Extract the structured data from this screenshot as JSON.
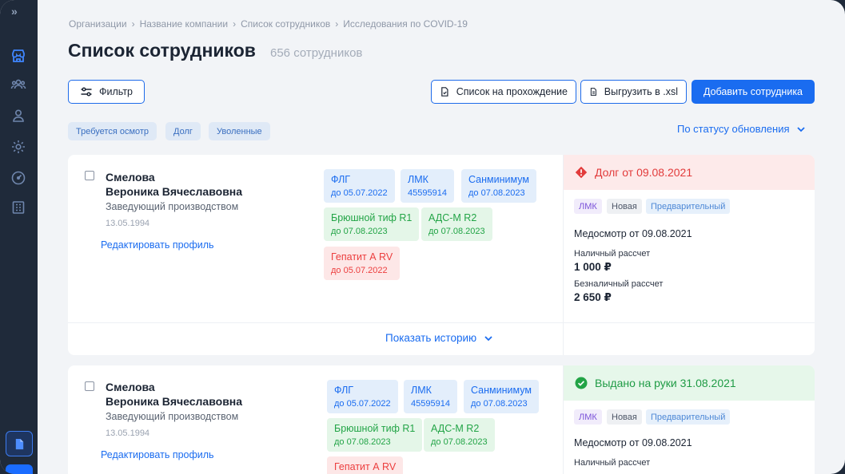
{
  "breadcrumbs": [
    "Организации",
    "Название компании",
    "Список сотрудников",
    "Исследования по COVID-19"
  ],
  "page": {
    "title": "Список сотрудников",
    "count": "656 сотрудников"
  },
  "toolbar": {
    "filter_label": "Фильтр",
    "pass_list_label": "Список на прохождение",
    "export_label": "Выгрузить в .xsl",
    "add_label": "Добавить сотрудника"
  },
  "chips": [
    "Требуется осмотр",
    "Долг",
    "Уволенные"
  ],
  "sort_label": "По статусу обновления",
  "history_label": "Показать историю",
  "colors": {
    "accent": "#1a6cf0",
    "debt": "#e23b3b",
    "issued": "#1f9b45",
    "sidebar": "#1f2a3a"
  },
  "sidebar_icons": [
    "expand-icon",
    "store-icon",
    "users-icon",
    "user-icon",
    "gear-icon",
    "gauge-icon",
    "building-icon",
    "document-icon"
  ],
  "employees": [
    {
      "name_line1": "Смелова",
      "name_line2": "Вероника Вячеславовна",
      "position": "Заведующий производством",
      "dob": "13.05.1994",
      "edit_label": "Редактировать профиль",
      "tests": [
        {
          "name": "ФЛГ",
          "sub": "до 05.07.2022",
          "color": "blue"
        },
        {
          "name": "ЛМК",
          "sub": "45595914",
          "color": "blue"
        },
        {
          "name": "Санминимум",
          "sub": "до 07.08.2023",
          "color": "blue"
        },
        {
          "name": "Брюшной тиф  R1",
          "sub": "до 07.08.2023",
          "color": "green"
        },
        {
          "name": "АДС-М  R2",
          "sub": "до 07.08.2023",
          "color": "green"
        },
        {
          "name": "Гепатит А  RV",
          "sub": "до 05.07.2022",
          "color": "red"
        }
      ],
      "status": "Долг от 09.08.2021",
      "status_type": "debt",
      "badges": [
        "ЛМК",
        "Новая",
        "Предварительный"
      ],
      "medical": "Медосмотр от 09.08.2021",
      "cash_label": "Наличный рассчет",
      "cash_value": "1 000 ₽",
      "noncash_label": "Безналичный рассчет",
      "noncash_value": "2 650 ₽"
    },
    {
      "name_line1": "Смелова",
      "name_line2": "Вероника Вячеславовна",
      "position": "Заведующий производством",
      "dob": "13.05.1994",
      "edit_label": "Редактировать профиль",
      "tests": [
        {
          "name": "ФЛГ",
          "sub": "до 05.07.2022",
          "color": "blue"
        },
        {
          "name": "ЛМК",
          "sub": "45595914",
          "color": "blue"
        },
        {
          "name": "Санминимум",
          "sub": "до 07.08.2023",
          "color": "blue"
        },
        {
          "name": "Брюшной тиф  R1",
          "sub": "до 07.08.2023",
          "color": "green"
        },
        {
          "name": "АДС-М  R2",
          "sub": "до 07.08.2023",
          "color": "green"
        },
        {
          "name": "Гепатит А  RV",
          "sub": "",
          "color": "red"
        }
      ],
      "status": "Выдано на руки 31.08.2021",
      "status_type": "issued",
      "badges": [
        "ЛМК",
        "Новая",
        "Предварительный"
      ],
      "medical": "Медосмотр от 09.08.2021",
      "cash_label": "Наличный рассчет"
    }
  ]
}
